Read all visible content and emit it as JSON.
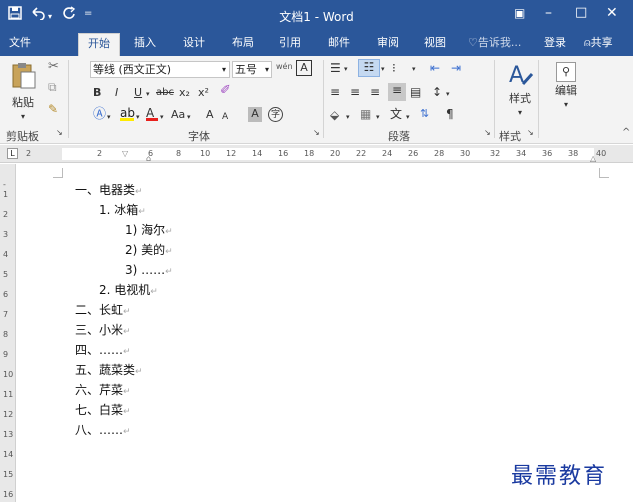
{
  "titlebar": {
    "title": "文档1 - Word",
    "save_icon": "save-icon",
    "undo_icon": "undo-icon",
    "redo_icon": "redo-icon",
    "customize_icon": "customize-icon",
    "min_glyph": "–",
    "max_glyph": "□",
    "close_glyph": "✕",
    "ribbon_opt_glyph": "▣"
  },
  "tabs": [
    "文件",
    "开始",
    "插入",
    "设计",
    "布局",
    "引用",
    "邮件",
    "审阅",
    "视图"
  ],
  "active_tab": "开始",
  "tell_me": "告诉我...",
  "login": "登录",
  "share": "共享",
  "ribbon": {
    "clipboard": {
      "paste": "粘贴",
      "label": "剪贴板"
    },
    "font": {
      "font_name": "等线 (西文正文)",
      "font_size": "五号",
      "wen": "wén",
      "label": "字体",
      "aa": "Aa",
      "bold": "B",
      "italic": "I",
      "underline": "U",
      "strike": "abc",
      "sub": "x₂",
      "sup": "x²",
      "grow": "A",
      "shrink": "A",
      "char_shade": "A",
      "enclose": "字"
    },
    "paragraph": {
      "label": "段落"
    },
    "styles": {
      "label": "样式",
      "button": "样式"
    },
    "editing": {
      "button": "编辑"
    }
  },
  "ruler": {
    "marks": [
      "2",
      "2",
      "4",
      "6",
      "8",
      "10",
      "12",
      "14",
      "16",
      "18",
      "20",
      "22",
      "24",
      "26",
      "28",
      "30",
      "32",
      "34",
      "36",
      "38",
      "40"
    ],
    "vmarks": [
      "1",
      "2",
      "3",
      "4",
      "5",
      "6",
      "7",
      "8",
      "9",
      "10",
      "11",
      "12",
      "13",
      "14",
      "15",
      "16"
    ]
  },
  "document": {
    "lines": [
      {
        "text": "一、电器类",
        "level": 0
      },
      {
        "text": "1.   冰箱",
        "level": 1
      },
      {
        "text": "1)   海尔",
        "level": 2
      },
      {
        "text": "2)   美的",
        "level": 2
      },
      {
        "text": "3)   ……",
        "level": 2
      },
      {
        "text": "2.   电视机",
        "level": 1
      },
      {
        "text": "二、长虹",
        "level": 0
      },
      {
        "text": "三、小米",
        "level": 0
      },
      {
        "text": "四、……",
        "level": 0
      },
      {
        "text": "五、蔬菜类",
        "level": 0
      },
      {
        "text": "六、芹菜",
        "level": 0
      },
      {
        "text": "七、白菜",
        "level": 0
      },
      {
        "text": "八、……",
        "level": 0
      }
    ],
    "para_mark": "↵"
  },
  "watermark": "最需教育"
}
